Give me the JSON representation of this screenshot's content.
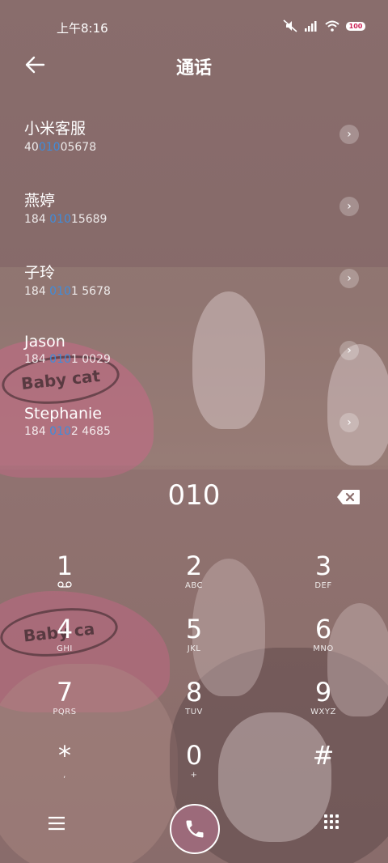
{
  "status_bar": {
    "time": "上午8:16",
    "battery": "100",
    "icons": [
      "mute-icon",
      "signal-icon",
      "wifi-icon",
      "battery-icon"
    ]
  },
  "header": {
    "title": "通话"
  },
  "contacts": [
    {
      "name": "小米客服",
      "num_pre": "40",
      "num_hl": "010",
      "num_post": "05678"
    },
    {
      "name": "燕婷",
      "num_pre": "184 ",
      "num_hl": "010",
      "num_post": "15689"
    },
    {
      "name": "子玲",
      "num_pre": "184 ",
      "num_hl": "010",
      "num_post": "1 5678"
    },
    {
      "name": "Jason",
      "num_pre": "184 ",
      "num_hl": "010",
      "num_post": "1 0029"
    },
    {
      "name": "Stephanie",
      "num_pre": "184 ",
      "num_hl": "010",
      "num_post": "2 4685"
    }
  ],
  "dialer": {
    "entered": "010",
    "keys": [
      {
        "digit": "1",
        "letters": "voicemail-icon"
      },
      {
        "digit": "2",
        "letters": "ABC"
      },
      {
        "digit": "3",
        "letters": "DEF"
      },
      {
        "digit": "4",
        "letters": "GHI"
      },
      {
        "digit": "5",
        "letters": "JKL"
      },
      {
        "digit": "6",
        "letters": "MNO"
      },
      {
        "digit": "7",
        "letters": "PQRS"
      },
      {
        "digit": "8",
        "letters": "TUV"
      },
      {
        "digit": "9",
        "letters": "WXYZ"
      },
      {
        "digit": "*",
        "letters": ","
      },
      {
        "digit": "0",
        "letters": "+"
      },
      {
        "digit": "#",
        "letters": ""
      }
    ]
  },
  "background_text": {
    "label1": "Baby cat",
    "label2": "Baby ca"
  },
  "colors": {
    "highlight": "#3f8cdb",
    "call_button": "#9c6a7a"
  }
}
